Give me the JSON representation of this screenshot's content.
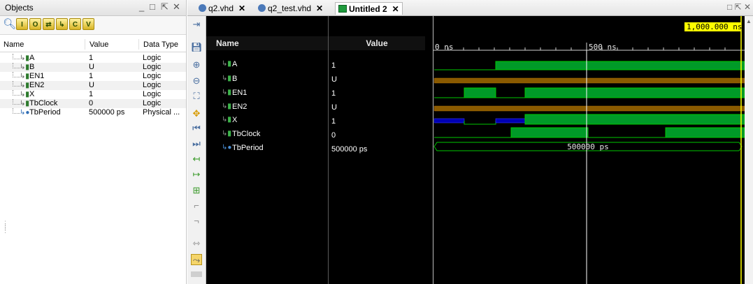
{
  "objects_panel": {
    "title": "Objects",
    "controls": [
      "_",
      "□",
      "⇱",
      "✕"
    ],
    "columns": {
      "name": "Name",
      "value": "Value",
      "type": "Data Type"
    },
    "rows": [
      {
        "name": "A",
        "value": "1",
        "type": "Logic"
      },
      {
        "name": "B",
        "value": "U",
        "type": "Logic"
      },
      {
        "name": "EN1",
        "value": "1",
        "type": "Logic"
      },
      {
        "name": "EN2",
        "value": "U",
        "type": "Logic"
      },
      {
        "name": "X",
        "value": "1",
        "type": "Logic"
      },
      {
        "name": "TbClock",
        "value": "0",
        "type": "Logic"
      },
      {
        "name": "TbPeriod",
        "value": "500000 ps",
        "type": "Physical ..."
      }
    ]
  },
  "tabs": [
    {
      "label": "q2.vhd",
      "close": "✕"
    },
    {
      "label": "q2_test.vhd",
      "close": "✕"
    },
    {
      "label": "Untitled 2",
      "close": "✕",
      "active": true
    }
  ],
  "wave_window": {
    "controls": [
      "□",
      "⇱",
      "✕"
    ],
    "name_header": "Name",
    "value_header": "Value",
    "cursor_time": "1,000.000 ns",
    "time_labels": [
      "0 ns",
      "500 ns"
    ],
    "signals": [
      {
        "name": "A",
        "value": "1"
      },
      {
        "name": "B",
        "value": "U"
      },
      {
        "name": "EN1",
        "value": "1"
      },
      {
        "name": "EN2",
        "value": "U"
      },
      {
        "name": "X",
        "value": "1"
      },
      {
        "name": "TbClock",
        "value": "0"
      },
      {
        "name": "TbPeriod",
        "value": "500000 ps"
      }
    ],
    "bus_label": "500000 ps",
    "colors": {
      "logic": "#00c800",
      "undefined": "#8a5a00",
      "highz": "#0000c8",
      "cursor": "#ffff00"
    }
  }
}
